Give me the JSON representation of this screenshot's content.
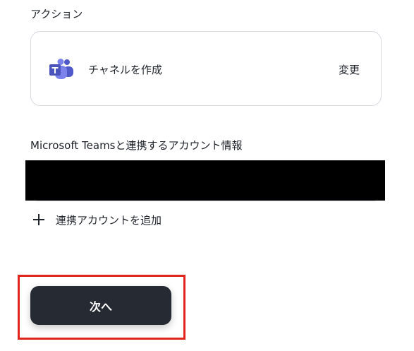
{
  "action_section": {
    "heading": "アクション",
    "action_name": "チャネルを作成",
    "change_label": "変更",
    "app_icon": "microsoft-teams-logo"
  },
  "account_section": {
    "heading": "Microsoft Teamsと連携するアカウント情報",
    "selected_account": "",
    "add_account_label": "連携アカウントを追加",
    "add_icon": "plus-icon"
  },
  "footer": {
    "next_label": "次へ",
    "highlight_color": "#e0261c",
    "button_color": "#262a33"
  }
}
